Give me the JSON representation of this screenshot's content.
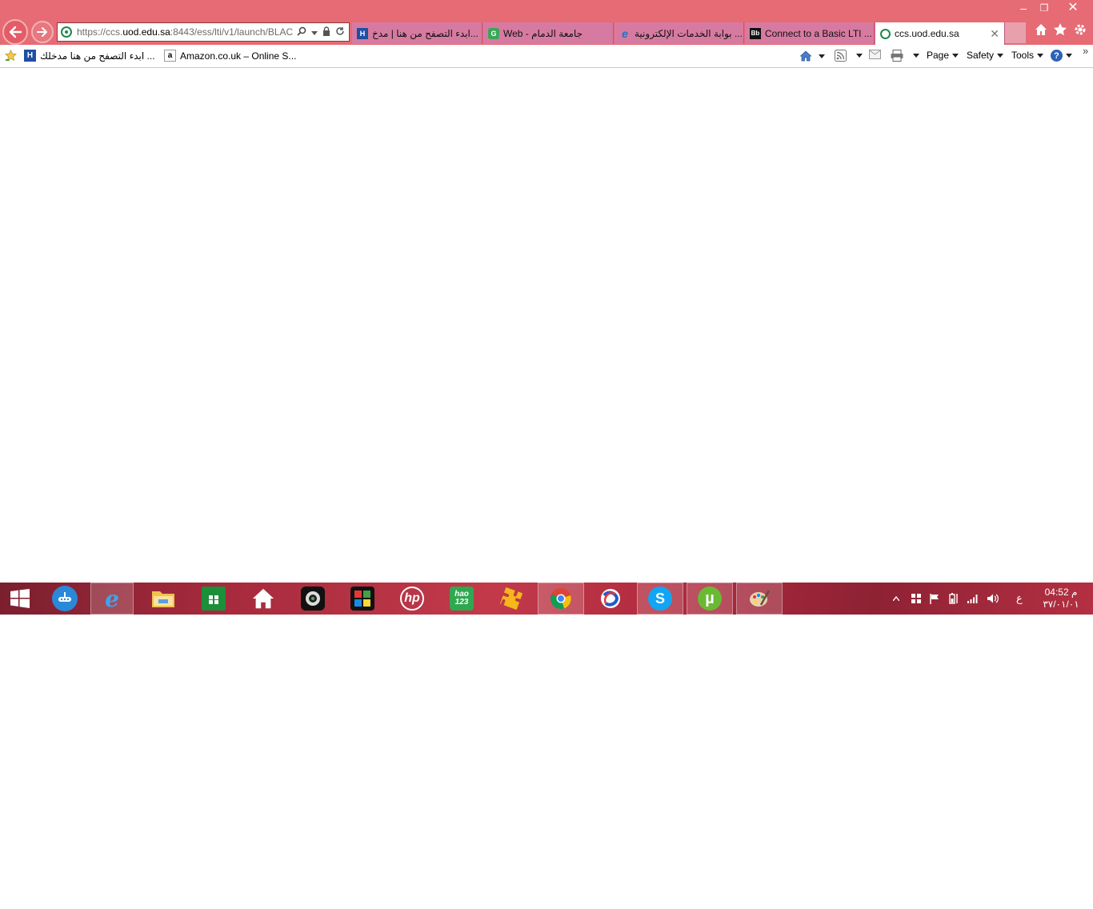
{
  "window": {
    "minimize_glyph": "–",
    "restore_glyph": "❐",
    "close_glyph": "✕"
  },
  "address": {
    "url_prefix": "https://ccs.",
    "url_domain": "uod.edu.sa",
    "url_suffix": ":8443/ess/lti/v1/launch/BLAC"
  },
  "tabs": [
    {
      "label": "ابدء التصفح من هنا | مدخ...",
      "icon": "bookmark-app-icon",
      "active": false
    },
    {
      "label": "Web - جامعة الدمام",
      "icon": "g-logo-icon",
      "active": false
    },
    {
      "label": "بوابة الخدمات الإلكترونية ...",
      "icon": "ie-page-icon",
      "active": false
    },
    {
      "label": "Connect to a Basic LTI ...",
      "icon": "blackboard-icon",
      "active": false
    },
    {
      "label": "ccs.uod.edu.sa",
      "icon": "site-icon",
      "active": true
    }
  ],
  "favorites": [
    {
      "label": "ابدء التصفح من هنا  مدخلك ...",
      "icon": "bookmark-app-icon"
    },
    {
      "label": "Amazon.co.uk – Online S...",
      "icon": "amazon-icon"
    }
  ],
  "command_bar": {
    "page_label": "Page",
    "safety_label": "Safety",
    "tools_label": "Tools",
    "help_glyph": "?",
    "chevron": "»"
  },
  "taskbar": {
    "apps": [
      {
        "name": "start-button",
        "glyph": "⊞"
      },
      {
        "name": "app-network",
        "glyph": "●"
      },
      {
        "name": "internet-explorer",
        "glyph": "e"
      },
      {
        "name": "file-explorer",
        "glyph": "▤"
      },
      {
        "name": "store",
        "glyph": "⊞"
      },
      {
        "name": "home-app",
        "glyph": "⌂"
      },
      {
        "name": "webcam-app",
        "glyph": "◉"
      },
      {
        "name": "puzzle-app",
        "glyph": "✤"
      },
      {
        "name": "hp-app",
        "glyph": "hp"
      },
      {
        "name": "hao123",
        "glyph": "hao 123"
      },
      {
        "name": "puzzle-key-app",
        "glyph": "✦"
      },
      {
        "name": "chrome",
        "glyph": "◍"
      },
      {
        "name": "orb-app",
        "glyph": "◐"
      },
      {
        "name": "skype",
        "glyph": "S"
      },
      {
        "name": "utorrent",
        "glyph": "µ"
      },
      {
        "name": "paint",
        "glyph": "✎"
      }
    ],
    "tray_lang": "ع",
    "clock_time": "04:52 م",
    "clock_date": "٣٧/٠١/٠١"
  }
}
